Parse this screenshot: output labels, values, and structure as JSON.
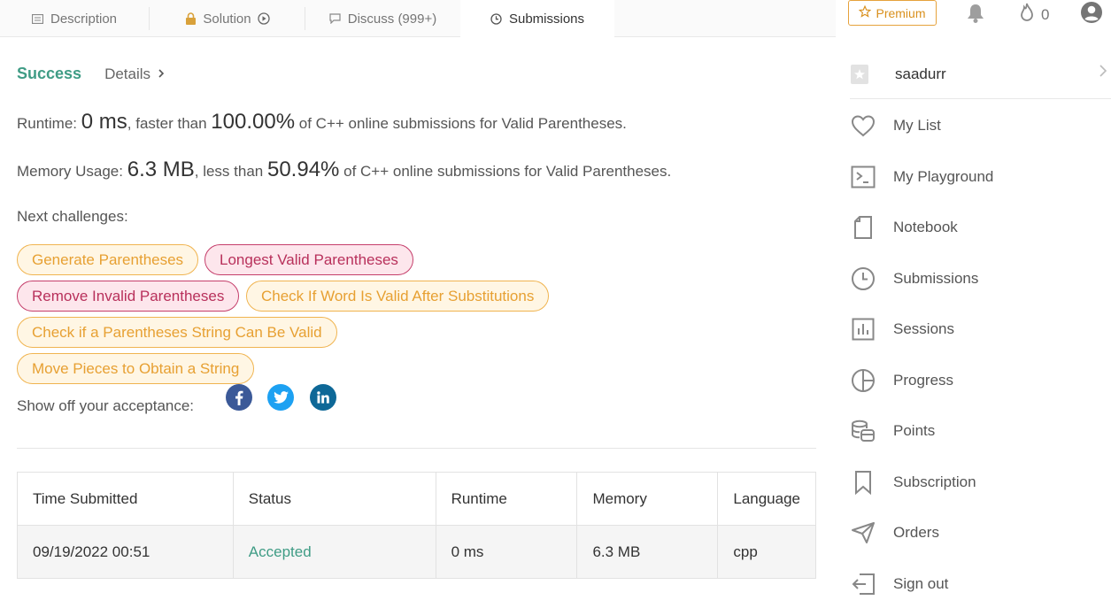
{
  "tabs": [
    {
      "label": "Description",
      "icon": "description-icon"
    },
    {
      "label": "Solution",
      "icon": "lock-icon"
    },
    {
      "label": "Discuss (999+)",
      "icon": "discuss-icon"
    },
    {
      "label": "Submissions",
      "icon": "clock-icon",
      "active": true
    }
  ],
  "header": {
    "premium_label": "Premium",
    "streak_count": "0"
  },
  "result": {
    "status": "Success",
    "details_label": "Details",
    "runtime": {
      "label": "Runtime:",
      "value": "0 ms",
      "connector": ", faster than",
      "percent": "100.00%",
      "suffix": "of C++ online submissions for Valid Parentheses."
    },
    "memory": {
      "label": "Memory Usage:",
      "value": "6.3 MB",
      "connector": ", less than",
      "percent": "50.94%",
      "suffix": "of C++ online submissions for Valid Parentheses."
    },
    "next_label": "Next challenges:",
    "challenges": [
      {
        "label": "Generate Parentheses",
        "difficulty": "medium"
      },
      {
        "label": "Longest Valid Parentheses",
        "difficulty": "hard"
      },
      {
        "label": "Remove Invalid Parentheses",
        "difficulty": "hard"
      },
      {
        "label": "Check If Word Is Valid After Substitutions",
        "difficulty": "medium"
      },
      {
        "label": "Check if a Parentheses String Can Be Valid",
        "difficulty": "medium"
      },
      {
        "label": "Move Pieces to Obtain a String",
        "difficulty": "medium"
      }
    ],
    "share_label": "Show off your acceptance:",
    "social_icons": [
      "facebook-icon",
      "twitter-icon",
      "linkedin-icon"
    ]
  },
  "table": {
    "headers": [
      "Time Submitted",
      "Status",
      "Runtime",
      "Memory",
      "Language"
    ],
    "rows": [
      [
        "09/19/2022 00:51",
        "Accepted",
        "0 ms",
        "6.3 MB",
        "cpp"
      ]
    ]
  },
  "menu": {
    "username": "saadurr",
    "items": [
      {
        "label": "My List",
        "icon": "heart-icon"
      },
      {
        "label": "My Playground",
        "icon": "terminal-icon"
      },
      {
        "label": "Notebook",
        "icon": "notebook-icon"
      },
      {
        "label": "Submissions",
        "icon": "clock-icon"
      },
      {
        "label": "Sessions",
        "icon": "bar-chart-icon"
      },
      {
        "label": "Progress",
        "icon": "pie-chart-icon"
      },
      {
        "label": "Points",
        "icon": "coins-icon"
      },
      {
        "label": "Subscription",
        "icon": "bookmark-icon"
      },
      {
        "label": "Orders",
        "icon": "send-icon"
      },
      {
        "label": "Sign out",
        "icon": "sign-out-icon"
      }
    ]
  },
  "colors": {
    "accent_green": "#3f9c85",
    "medium": "#e7a032",
    "hard": "#b8305b",
    "premium": "#d9901d"
  }
}
